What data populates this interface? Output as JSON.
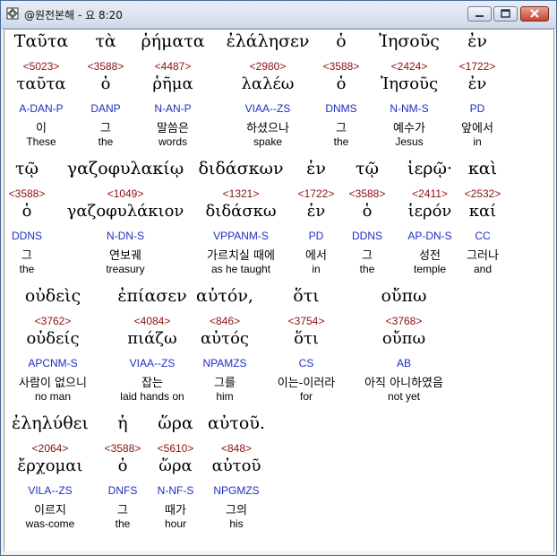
{
  "window": {
    "title": "@원전본해 - 요 8:20",
    "controls": {
      "minimize": "minimize",
      "maximize": "maximize",
      "close": "close"
    }
  },
  "rows": [
    {
      "words": [
        {
          "greek": "Ταῦτα",
          "strong": "<5023>",
          "lemma": "ταῦτα",
          "parse": "A-DAN-P",
          "korean": "이",
          "english": "These"
        },
        {
          "greek": "τὰ",
          "strong": "<3588>",
          "lemma": "ὁ",
          "parse": "DANP",
          "korean": "그",
          "english": "the"
        },
        {
          "greek": "ῥήματα",
          "strong": "<4487>",
          "lemma": "ῥῆμα",
          "parse": "N-AN-P",
          "korean": "말씀은",
          "english": "words"
        },
        {
          "greek": "ἐλάλησεν",
          "strong": "<2980>",
          "lemma": "λαλέω",
          "parse": "VIAA--ZS",
          "korean": "하셨으나",
          "english": "spake"
        },
        {
          "greek": "ὁ",
          "strong": "<3588>",
          "lemma": "ὁ",
          "parse": "DNMS",
          "korean": "그",
          "english": "the"
        },
        {
          "greek": "Ἰησοῦς",
          "strong": "<2424>",
          "lemma": "Ἰησοῦς",
          "parse": "N-NM-S",
          "korean": "예수가",
          "english": "Jesus"
        },
        {
          "greek": "ἐν",
          "strong": "<1722>",
          "lemma": "ἐν",
          "parse": "PD",
          "korean": "앞에서",
          "english": "in"
        }
      ]
    },
    {
      "words": [
        {
          "greek": "τῷ",
          "strong": "<3588>",
          "lemma": "ὁ",
          "parse": "DDNS",
          "korean": "그",
          "english": "the"
        },
        {
          "greek": "γαζοφυλακίῳ",
          "strong": "<1049>",
          "lemma": "γαζοφυλάκιον",
          "parse": "N-DN-S",
          "korean": "연보궤",
          "english": "treasury"
        },
        {
          "greek": "διδάσκων",
          "strong": "<1321>",
          "lemma": "διδάσκω",
          "parse": "VPPANM-S",
          "korean": "가르치실 때에",
          "english": "as he taught"
        },
        {
          "greek": "ἐν",
          "strong": "<1722>",
          "lemma": "ἐν",
          "parse": "PD",
          "korean": "에서",
          "english": "in"
        },
        {
          "greek": "τῷ",
          "strong": "<3588>",
          "lemma": "ὁ",
          "parse": "DDNS",
          "korean": "그",
          "english": "the"
        },
        {
          "greek": "ἱερῷ·",
          "strong": "<2411>",
          "lemma": "ἱερόν",
          "parse": "AP-DN-S",
          "korean": "성전",
          "english": "temple"
        },
        {
          "greek": "καὶ",
          "strong": "<2532>",
          "lemma": "καί",
          "parse": "CC",
          "korean": "그러나",
          "english": "and"
        }
      ]
    },
    {
      "words": [
        {
          "greek": "οὐδεὶς",
          "strong": "<3762>",
          "lemma": "οὐδείς",
          "parse": "APCNM-S",
          "korean": "사람이 없으니",
          "english": "no man"
        },
        {
          "greek": "ἐπίασεν",
          "strong": "<4084>",
          "lemma": "πιάζω",
          "parse": "VIAA--ZS",
          "korean": "잡는",
          "english": "laid hands on"
        },
        {
          "greek": "αὐτόν,",
          "strong": "<846>",
          "lemma": "αὐτός",
          "parse": "NPAMZS",
          "korean": "그를",
          "english": "him"
        },
        {
          "greek": "ὅτι",
          "strong": "<3754>",
          "lemma": "ὅτι",
          "parse": "CS",
          "korean": "이는-이러라",
          "english": "for"
        },
        {
          "greek": "οὔπω",
          "strong": "<3768>",
          "lemma": "οὔπω",
          "parse": "AB",
          "korean": "아직 아니하였음",
          "english": "not yet"
        }
      ]
    },
    {
      "words": [
        {
          "greek": "ἐληλύθει",
          "strong": "<2064>",
          "lemma": "ἔρχομαι",
          "parse": "VILA--ZS",
          "korean": "이르지",
          "english": "was-come"
        },
        {
          "greek": "ἡ",
          "strong": "<3588>",
          "lemma": "ὁ",
          "parse": "DNFS",
          "korean": "그",
          "english": "the"
        },
        {
          "greek": "ὥρα",
          "strong": "<5610>",
          "lemma": "ὥρα",
          "parse": "N-NF-S",
          "korean": "때가",
          "english": "hour"
        },
        {
          "greek": "αὐτοῦ.",
          "strong": "<848>",
          "lemma": "αὐτοῦ",
          "parse": "NPGMZS",
          "korean": "그의",
          "english": "his"
        }
      ]
    }
  ],
  "colors": {
    "strong": "#8b1010",
    "parse": "#1b2fc2",
    "text": "#000000",
    "background": "#ffffff"
  }
}
